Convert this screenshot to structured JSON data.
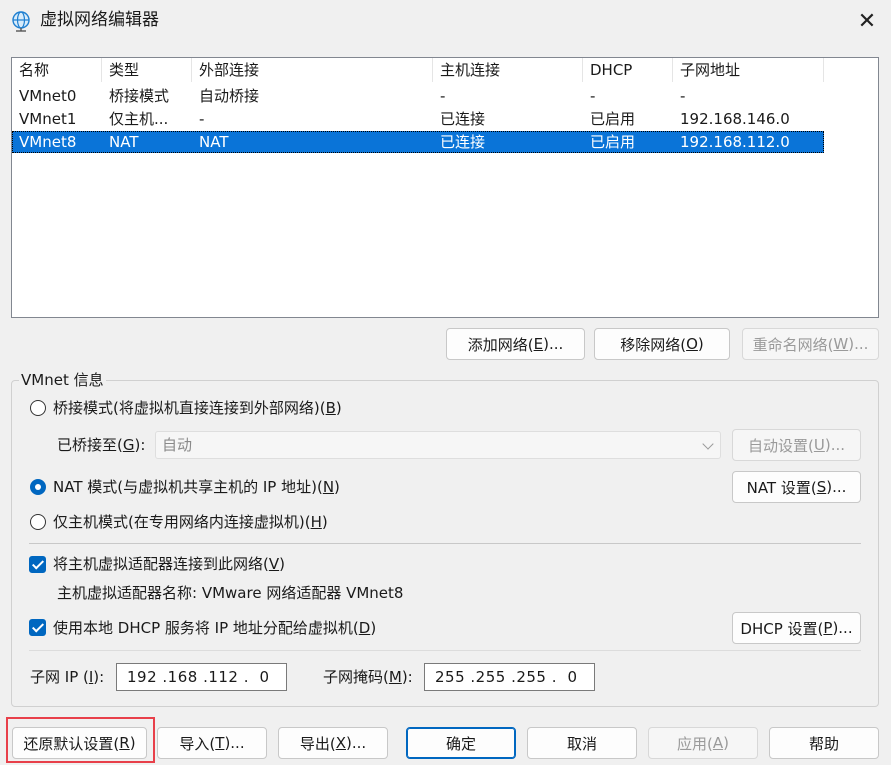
{
  "window": {
    "title": "虚拟网络编辑器",
    "close_symbol": "✕"
  },
  "colors": {
    "accent": "#0067c0",
    "selection": "#0a74d8",
    "highlight_box": "#e8404a"
  },
  "table": {
    "headers": [
      "名称",
      "类型",
      "外部连接",
      "主机连接",
      "DHCP",
      "子网地址"
    ],
    "rows": [
      [
        "VMnet0",
        "桥接模式",
        "自动桥接",
        "-",
        "-",
        "-"
      ],
      [
        "VMnet1",
        "仅主机...",
        "-",
        "已连接",
        "已启用",
        "192.168.146.0"
      ],
      [
        "VMnet8",
        "NAT",
        "NAT",
        "已连接",
        "已启用",
        "192.168.112.0"
      ]
    ],
    "selected_row": 2
  },
  "list_buttons": {
    "add": {
      "pre": "添加网络(",
      "key": "E",
      "post": ")..."
    },
    "remove": {
      "pre": "移除网络(",
      "key": "O",
      "post": ")"
    },
    "rename": {
      "pre": "重命名网络(",
      "key": "W",
      "post": ")..."
    }
  },
  "info": {
    "group_label": "VMnet 信息",
    "bridge": {
      "pre": "桥接模式(将虚拟机直接连接到外部网络)(",
      "key": "B",
      "post": ")",
      "checked": false
    },
    "bridged_to": {
      "pre": "已桥接至(",
      "key": "G",
      "post": "):",
      "value": "自动"
    },
    "auto_settings": {
      "pre": "自动设置(",
      "key": "U",
      "post": ")..."
    },
    "nat": {
      "pre": "NAT 模式(与虚拟机共享主机的 IP 地址)(",
      "key": "N",
      "post": ")",
      "checked": true
    },
    "nat_settings": {
      "pre": "NAT 设置(",
      "key": "S",
      "post": ")..."
    },
    "host_only": {
      "pre": "仅主机模式(在专用网络内连接虚拟机)(",
      "key": "H",
      "post": ")",
      "checked": false
    },
    "connect_adapter": {
      "pre": "将主机虚拟适配器连接到此网络(",
      "key": "V",
      "post": ")",
      "checked": true
    },
    "adapter_name": "主机虚拟适配器名称: VMware 网络适配器 VMnet8",
    "use_dhcp": {
      "pre": "使用本地 DHCP 服务将 IP 地址分配给虚拟机(",
      "key": "D",
      "post": ")",
      "checked": true
    },
    "dhcp_settings": {
      "pre": "DHCP 设置(",
      "key": "P",
      "post": ")..."
    },
    "subnet_ip": {
      "pre": "子网 IP (",
      "key": "I",
      "post": "):",
      "value": "192 .168 .112 .  0"
    },
    "subnet_mask": {
      "pre": "子网掩码(",
      "key": "M",
      "post": "):",
      "value": "255 .255 .255 .  0"
    }
  },
  "footer": {
    "restore": {
      "pre": "还原默认设置(",
      "key": "R",
      "post": ")"
    },
    "import": {
      "pre": "导入(",
      "key": "T",
      "post": ")..."
    },
    "export": {
      "pre": "导出(",
      "key": "X",
      "post": ")..."
    },
    "ok": "确定",
    "cancel": "取消",
    "apply": {
      "pre": "应用(",
      "key": "A",
      "post": ")"
    },
    "help": "帮助"
  }
}
